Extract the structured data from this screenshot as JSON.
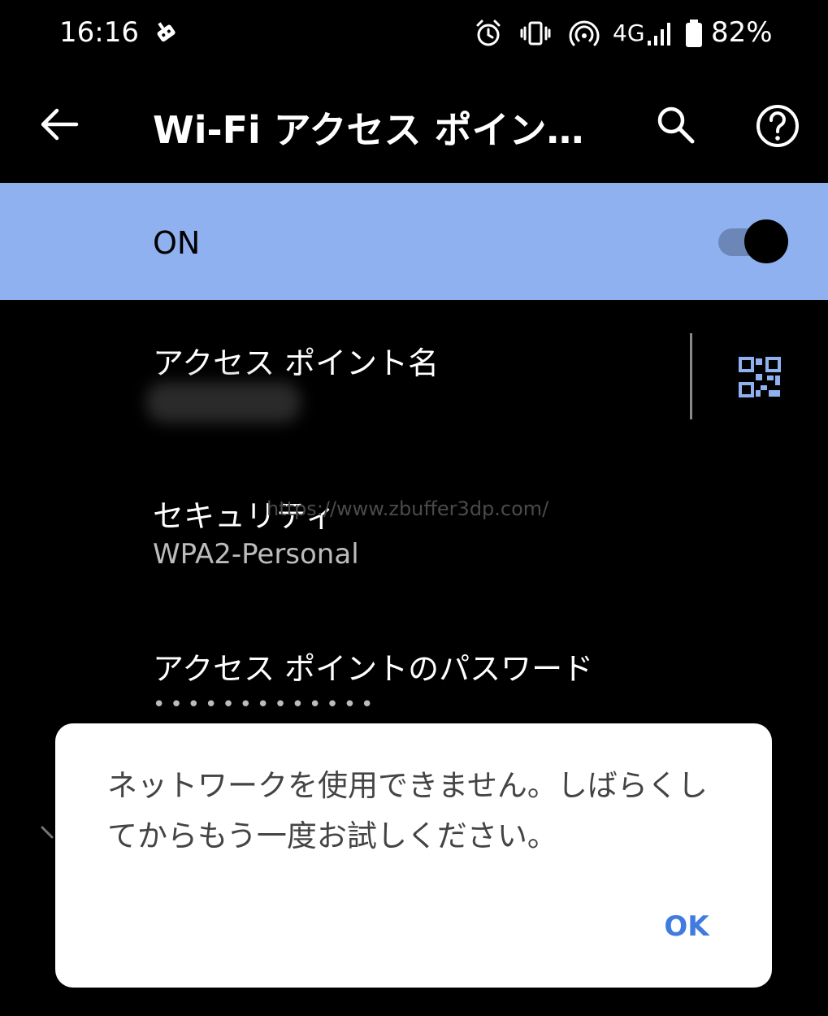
{
  "status_bar": {
    "time": "16:16",
    "network": "4G",
    "battery": "82%",
    "icons": [
      "notification-icon",
      "alarm-icon",
      "vibrate-icon",
      "hotspot-icon",
      "signal-icon",
      "battery-icon"
    ]
  },
  "app_bar": {
    "title": "Wi-Fi アクセス ポイン…",
    "icons": [
      "back-arrow-icon",
      "search-icon",
      "help-icon"
    ]
  },
  "main_switch": {
    "label": "ON",
    "checked": true,
    "color": "#8fb1ef"
  },
  "preferences": [
    {
      "title": "アクセス ポイント名",
      "summary": ""
    },
    {
      "title": "セキュリティ",
      "summary": "WPA2-Personal"
    },
    {
      "title": "アクセス ポイントのパスワード",
      "summary": "•••••••••••••"
    }
  ],
  "watermark": "https://www.zbuffer3dp.com/",
  "dialog": {
    "message": "ネットワークを使用できません。しばらくしてからもう一度お試しください。",
    "ok_label": "OK",
    "accent": "#3f7be0"
  }
}
